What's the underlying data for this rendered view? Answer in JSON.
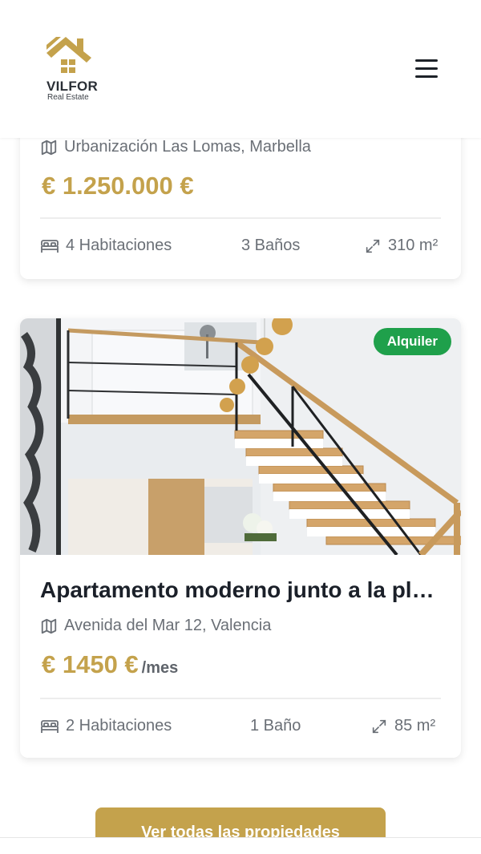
{
  "brand": {
    "name": "VILFOR",
    "tagline": "Real Estate",
    "accent": "#c4a24c"
  },
  "header": {
    "menu_icon": "hamburger-icon"
  },
  "listings": [
    {
      "address": "Urbanización Las Lomas, Marbella",
      "price": "€ 1.250.000 €",
      "price_suffix": "",
      "bedrooms": "4 Habitaciones",
      "bathrooms": "3 Baños",
      "area": "310 m²"
    },
    {
      "badge": "Alquiler",
      "badge_color": "#1fa04b",
      "title": "Apartamento moderno junto a la playa",
      "address": "Avenida del Mar 12, Valencia",
      "price": "€ 1450 €",
      "price_suffix": "/mes",
      "bedrooms": "2 Habitaciones",
      "bathrooms": "1 Baño",
      "area": "85 m²"
    }
  ],
  "cta": {
    "label": "Ver todas las propiedades"
  }
}
